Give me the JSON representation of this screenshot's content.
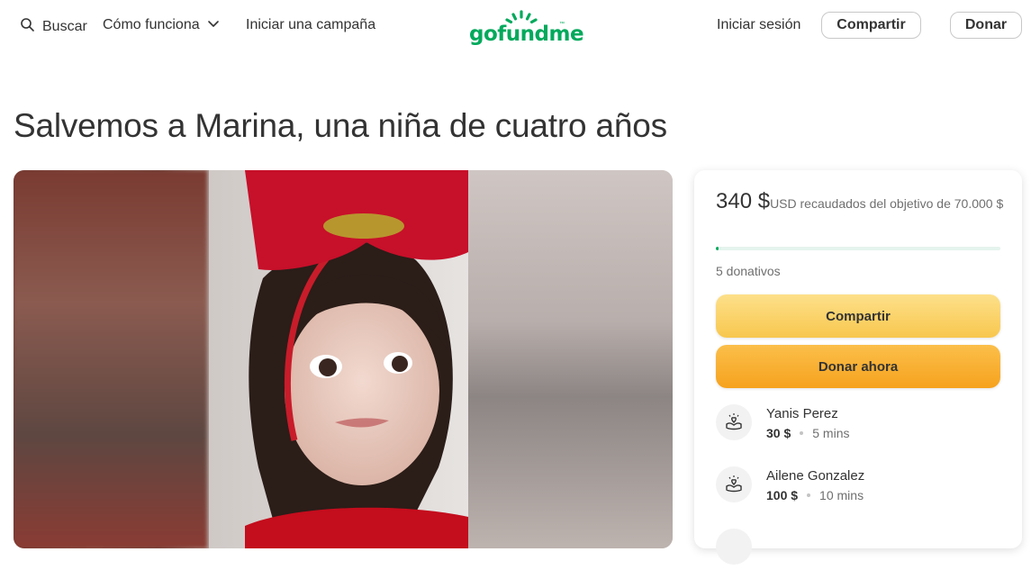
{
  "header": {
    "search_label": "Buscar",
    "how_label": "Cómo funciona",
    "start_label": "Iniciar una campaña",
    "logo_text": "gofundme",
    "logo_tm": "™",
    "login_label": "Iniciar sesión",
    "share_label": "Compartir",
    "donate_label": "Donar",
    "brand_color": "#02a95c"
  },
  "campaign": {
    "title": "Salvemos a Marina, una niña de cuatro años"
  },
  "card": {
    "raised_amount": "340 $",
    "raised_label": "USD recaudados del objetivo de 70.000 $",
    "progress_fraction": 0.005,
    "donor_count": "5 donativos",
    "share_label": "Compartir",
    "donate_label": "Donar ahora",
    "donations": [
      {
        "name": "Yanis Perez",
        "amount": "30 $",
        "time": "5 mins"
      },
      {
        "name": "Ailene Gonzalez",
        "amount": "100 $",
        "time": "10 mins"
      }
    ]
  }
}
